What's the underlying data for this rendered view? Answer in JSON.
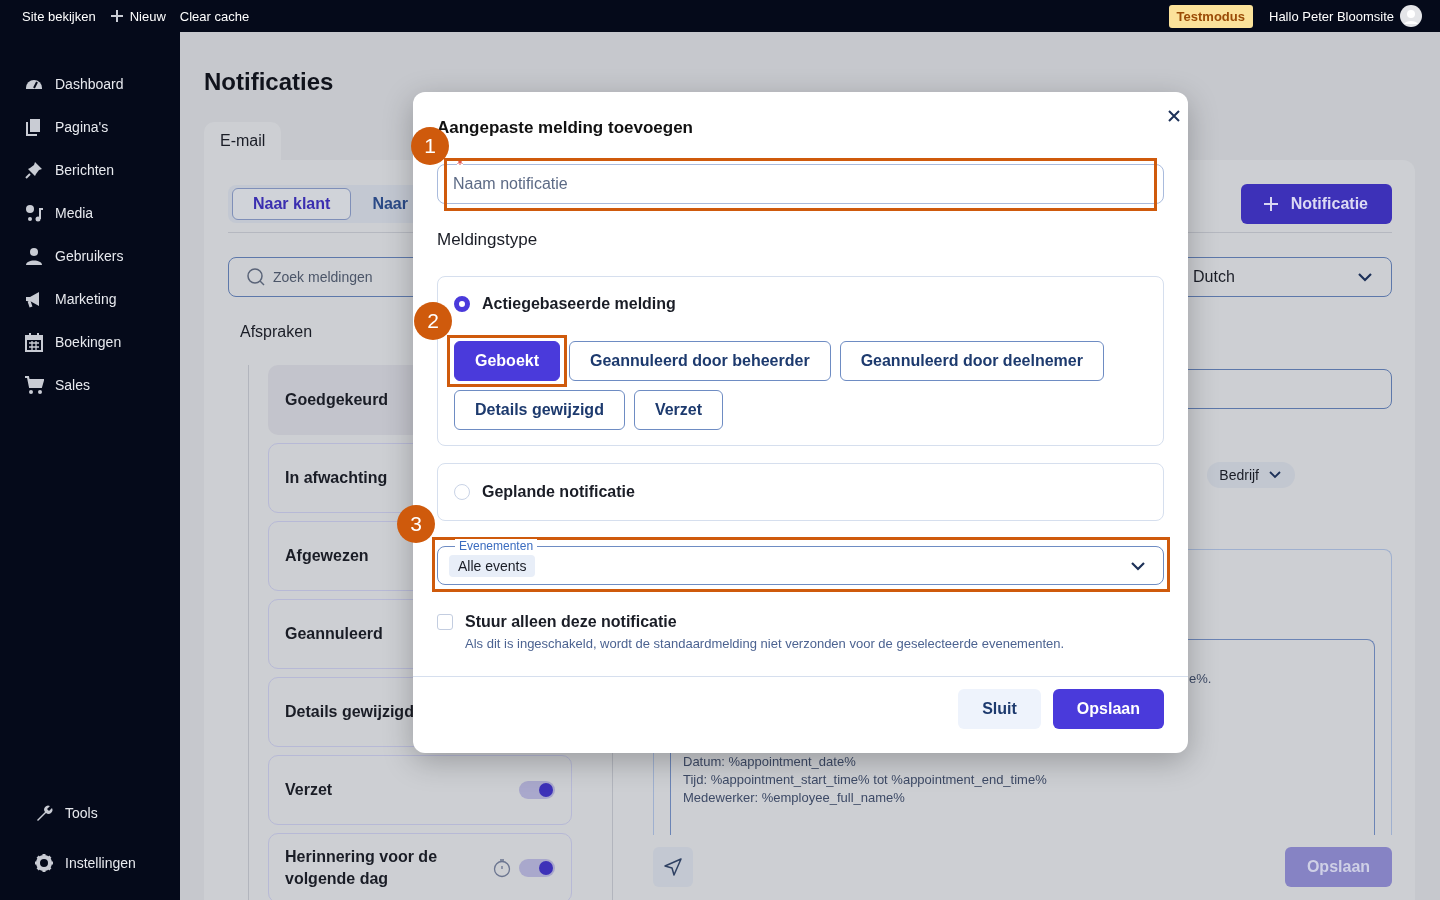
{
  "topbar": {
    "site_link": "Site bekijken",
    "new_link": "Nieuw",
    "cache_link": "Clear cache",
    "mode_badge": "Testmodus",
    "greeting": "Hallo Peter Bloomsite"
  },
  "sidebar": {
    "items": [
      {
        "label": "Dashboard"
      },
      {
        "label": "Pagina's"
      },
      {
        "label": "Berichten"
      },
      {
        "label": "Media"
      },
      {
        "label": "Gebruikers"
      },
      {
        "label": "Marketing"
      },
      {
        "label": "Boekingen"
      },
      {
        "label": "Sales"
      }
    ],
    "bottom_items": [
      {
        "label": "Tools"
      },
      {
        "label": "Instellingen"
      }
    ]
  },
  "page": {
    "title": "Notificaties",
    "tabs": [
      {
        "label": "E-mail",
        "selected": true
      }
    ],
    "audience_tabs": [
      {
        "label": "Naar klant",
        "selected": true
      },
      {
        "label": "Naar",
        "selected": false
      }
    ],
    "add_button": "Notificatie",
    "search": {
      "placeholder": "Zoek meldingen"
    },
    "language_select": {
      "value": "Dutch"
    },
    "group_title": "Afspraken",
    "notifications": [
      {
        "label": "Goedgekeurd",
        "selected": true
      },
      {
        "label": "In afwachting",
        "selected": false
      },
      {
        "label": "Afgewezen",
        "selected": false
      },
      {
        "label": "Geannuleerd",
        "selected": false
      },
      {
        "label": "Details gewijzigd",
        "selected": false
      },
      {
        "label": "Verzet",
        "selected": false,
        "kind": "plain",
        "on": true
      },
      {
        "label": "Herinnering voor de volgende dag",
        "selected": false,
        "kind": "timed",
        "on": true
      }
    ],
    "detail": {
      "chips": [
        "Bedrijf"
      ],
      "text_fragment": "e%.",
      "body_lines": [
        "Datum: %appointment_date%",
        "Tijd: %appointment_start_time% tot %appointment_end_time%",
        "Medewerker: %employee_full_name%"
      ],
      "save_button": {
        "label": "Opslaan",
        "disabled": true
      }
    }
  },
  "modal": {
    "title": "Aangepaste melding toevoegen",
    "name_field": {
      "placeholder": "Naam notificatie",
      "required": true
    },
    "type_label": "Meldingstype",
    "options": [
      {
        "label": "Actiegebaseerde melding",
        "selected": true,
        "events": [
          {
            "label": "Geboekt",
            "selected": true
          },
          {
            "label": "Geannuleerd door beheerder",
            "selected": false
          },
          {
            "label": "Geannuleerd door deelnemer",
            "selected": false
          },
          {
            "label": "Details gewijzigd",
            "selected": false
          },
          {
            "label": "Verzet",
            "selected": false
          }
        ]
      },
      {
        "label": "Geplande notificatie",
        "selected": false
      }
    ],
    "events_field": {
      "label": "Evenementen",
      "chips": [
        "Alle events"
      ]
    },
    "exclusive": {
      "label": "Stuur alleen deze notificatie",
      "hint": "Als dit is ingeschakeld, wordt de standaardmelding niet verzonden voor de geselecteerde evenementen.",
      "checked": false
    },
    "buttons": [
      {
        "label": "Sluit",
        "kind": "secondary"
      },
      {
        "label": "Opslaan",
        "kind": "primary"
      }
    ]
  },
  "annotations": [
    {
      "number": "1"
    },
    {
      "number": "2"
    },
    {
      "number": "3"
    }
  ]
}
